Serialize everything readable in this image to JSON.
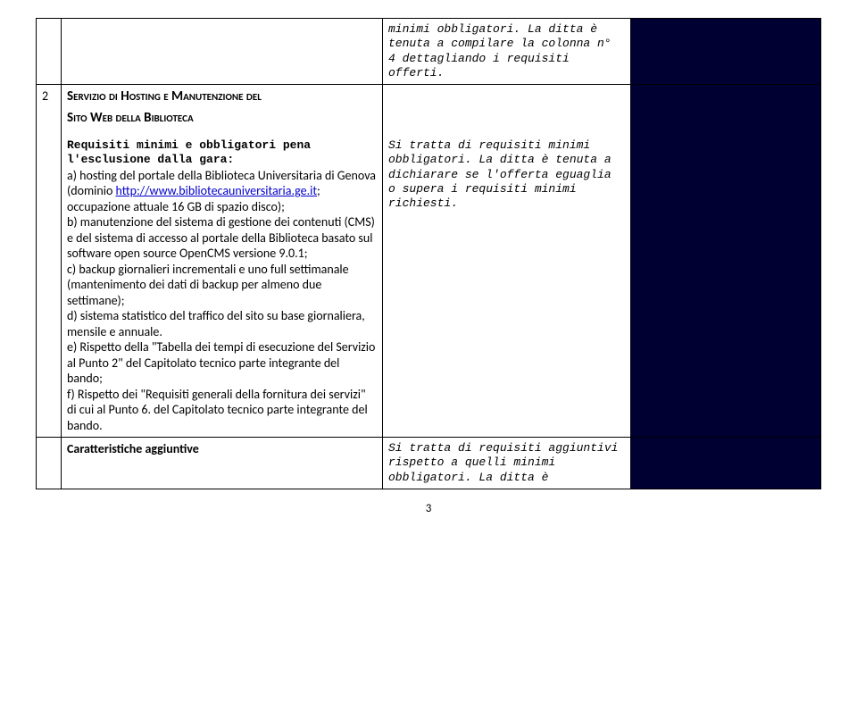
{
  "topRow": {
    "col2_text": "minimi obbligatori. La ditta è tenuta a compilare la colonna n° 4 dettagliando i requisiti offerti."
  },
  "section2": {
    "number": "2",
    "heading_line1": "Servizio di Hosting e Manutenzione del",
    "heading_line2": "Sito Web della Biblioteca",
    "req_intro": "Requisiti minimi e obbligatori pena l'esclusione dalla gara:",
    "a_prefix": "a) hosting del portale della Biblioteca Universitaria di Genova (dominio ",
    "link_text": "http://www.bibliotecauniversitaria.ge.it",
    "a_suffix": "; occupazione attuale 16 GB di spazio disco);",
    "b": "b) manutenzione del sistema di gestione dei contenuti (CMS) e del sistema di accesso al portale della Biblioteca basato sul software open source OpenCMS versione 9.0.1;",
    "c": "c) backup giornalieri incrementali e uno full settimanale (mantenimento dei dati di backup per almeno due settimane);",
    "d": "d) sistema statistico del traffico del sito su base giornaliera, mensile e annuale.",
    "e": "e) Rispetto della \"Tabella dei tempi di esecuzione del Servizio al Punto 2\" del Capitolato tecnico parte integrante del bando;",
    "f": "f) Rispetto dei \"Requisiti generali della fornitura dei servizi\" di cui al Punto 6. del Capitolato tecnico parte integrante del bando.",
    "col2_text": "Si tratta di requisiti minimi obbligatori. La ditta è tenuta a dichiarare se l'offerta eguaglia o supera i requisiti minimi richiesti."
  },
  "section2b": {
    "label": "Caratteristiche aggiuntive",
    "col2_text": "Si tratta di requisiti aggiuntivi rispetto a quelli minimi obbligatori. La ditta è"
  },
  "pageNumber": "3"
}
